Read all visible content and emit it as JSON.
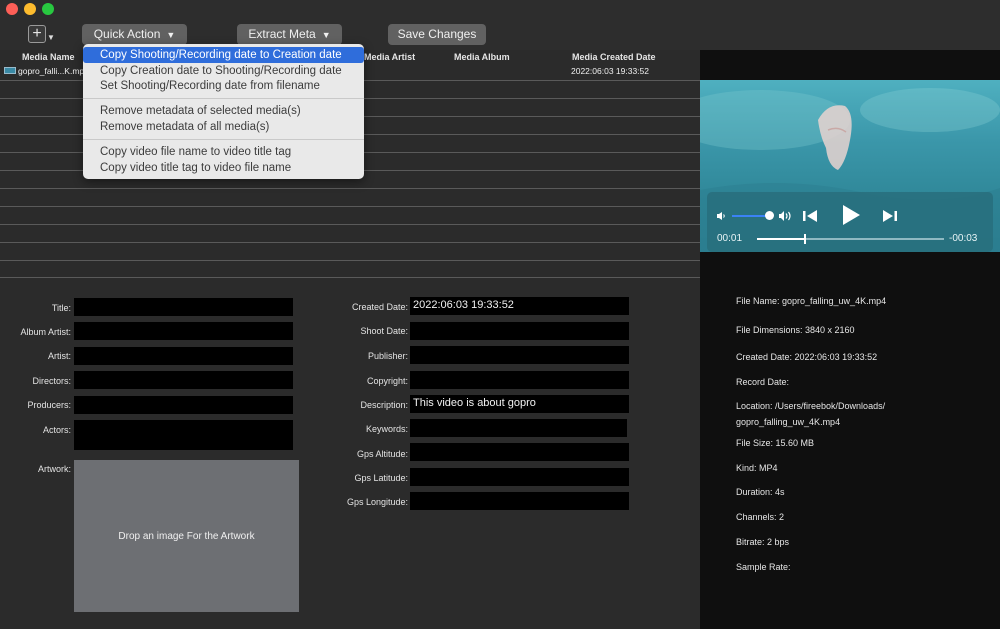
{
  "toolbar": {
    "add_symbol": "+",
    "quick_action_label": "Quick Action",
    "extract_meta_label": "Extract Meta",
    "save_changes_label": "Save Changes"
  },
  "table": {
    "columns": [
      "Media Name",
      "Media Artist",
      "Media Album",
      "Media Created Date"
    ],
    "rows": [
      {
        "name": "gopro_falli...K.mp4",
        "artist": "",
        "album": "",
        "created": "2022:06:03 19:33:52"
      }
    ]
  },
  "menu": {
    "items": [
      "Copy Shooting/Recording date to Creation date",
      "Copy Creation date to Shooting/Recording date",
      "Set Shooting/Recording date from filename",
      "Remove metadata of selected media(s)",
      "Remove metadata of all media(s)",
      "Copy video file name to video title tag",
      "Copy video title tag to video file name"
    ],
    "selected_index": 0
  },
  "player": {
    "elapsed": "00:01",
    "remaining": "-00:03",
    "volume": 0.8,
    "progress": 0.25
  },
  "info": {
    "file_name": "File Name: gopro_falling_uw_4K.mp4",
    "dimensions": "File Dimensions: 3840 x 2160",
    "created_date": "Created Date: 2022:06:03 19:33:52",
    "record_date": "Record Date:",
    "location_line1": "Location: /Users/fireebok/Downloads/",
    "location_line2": "gopro_falling_uw_4K.mp4",
    "file_size": "File Size: 15.60 MB",
    "kind": "Kind: MP4",
    "duration": "Duration: 4s",
    "channels": "Channels: 2",
    "bitrate": "Bitrate: 2 bps",
    "sample_rate": "Sample Rate:"
  },
  "form_left": {
    "title_label": "Title:",
    "title_value": "",
    "album_artist_label": "Album Artist:",
    "album_artist_value": "",
    "artist_label": "Artist:",
    "artist_value": "",
    "directors_label": "Directors:",
    "directors_value": "",
    "producers_label": "Producers:",
    "producers_value": "",
    "actors_label": "Actors:",
    "actors_value": "",
    "artwork_label": "Artwork:",
    "artwork_placeholder": "Drop an image For the Artwork"
  },
  "form_right": {
    "created_date_label": "Created Date:",
    "created_date_value": "2022:06:03 19:33:52",
    "shoot_date_label": "Shoot Date:",
    "shoot_date_value": "",
    "publisher_label": "Publisher:",
    "publisher_value": "",
    "copyright_label": "Copyright:",
    "copyright_value": "",
    "description_label": "Description:",
    "description_value": "This video is about gopro",
    "keywords_label": "Keywords:",
    "keywords_value": "",
    "gps_altitude_label": "Gps Altitude:",
    "gps_altitude_value": "",
    "gps_latitude_label": "Gps Latitude:",
    "gps_latitude_value": "",
    "gps_longitude_label": "Gps Longitude:",
    "gps_longitude_value": ""
  }
}
